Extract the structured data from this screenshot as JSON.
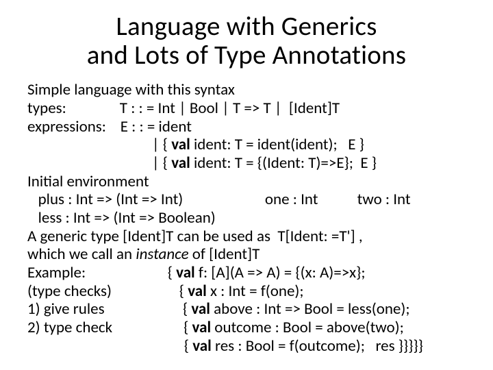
{
  "title_line1": "Language with Generics",
  "title_line2": "and Lots of Type Annotations",
  "lines": {
    "l1": "Simple language with this syntax",
    "l2": "types:               T : : = Int | Bool | T => T |  [Ident]T",
    "l3": "expressions:    E : : = ident",
    "l4_pre": "                                   | { ",
    "l4_val": "val",
    "l4_post": " ident: T = ident(ident);   E }",
    "l5_pre": "                                   | { ",
    "l5_val": "val",
    "l5_post": " ident: T = {(Ident: T)=>E};  E }",
    "l6": "Initial environment",
    "l7": "   plus : Int => (Int => Int)                       one : Int           two : Int",
    "l8": "   less : Int => (Int => Boolean)",
    "l9a": "A generic type [Ident]T can be used as  T[Ident: =T'] ,",
    "l9b_pre": "which we call an ",
    "l9b_em": "instance",
    "l9b_post": " of [Ident]T",
    "l10_pre": "Example:                       { ",
    "l10_val": "val",
    "l10_post": " f: [A](A => A) = {(x: A)=>x};",
    "l11_pre": "(type checks)                   { ",
    "l11_val": "val",
    "l11_post": " x : Int = f(one);",
    "l12_pre": "1) give rules                      { ",
    "l12_val": "val",
    "l12_post": " above : Int => Bool = less(one);",
    "l13_pre": "2) type check                    { ",
    "l13_val": "val",
    "l13_post": " outcome : Bool = above(two);",
    "l14_pre": "                                            { ",
    "l14_val": "val",
    "l14_post": " res : Bool = f(outcome);   res }}}}}"
  }
}
